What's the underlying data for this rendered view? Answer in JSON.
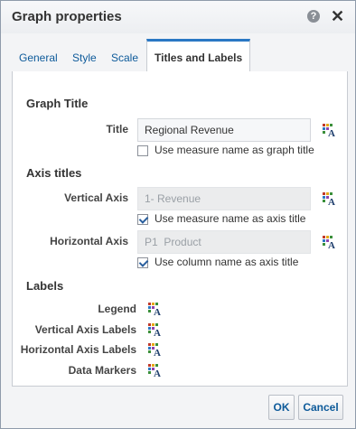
{
  "dialog": {
    "title": "Graph properties",
    "help_label": "?",
    "close_label": "✕"
  },
  "tabs": [
    {
      "label": "General"
    },
    {
      "label": "Style"
    },
    {
      "label": "Scale"
    },
    {
      "label": "Titles and Labels",
      "active": true
    }
  ],
  "graph_title": {
    "heading": "Graph Title",
    "title_label": "Title",
    "title_value": "Regional Revenue",
    "use_measure_label": "Use measure name as graph title",
    "use_measure_checked": false
  },
  "axis_titles": {
    "heading": "Axis titles",
    "vertical_label": "Vertical Axis",
    "vertical_value": "1- Revenue",
    "vertical_use_label": "Use measure name as axis title",
    "vertical_use_checked": true,
    "horizontal_label": "Horizontal Axis",
    "horizontal_value": "P1  Product",
    "horizontal_use_label": "Use column name as axis title",
    "horizontal_use_checked": true
  },
  "labels": {
    "heading": "Labels",
    "legend": "Legend",
    "vertical_axis_labels": "Vertical Axis Labels",
    "horizontal_axis_labels": "Horizontal Axis Labels",
    "data_markers": "Data Markers"
  },
  "buttons": {
    "ok": "OK",
    "cancel": "Cancel"
  },
  "colors": {
    "accent": "#2a78c4",
    "link": "#0d5a9a"
  },
  "icons": {
    "format": "format-text-icon",
    "help": "help-icon",
    "close": "close-icon"
  }
}
